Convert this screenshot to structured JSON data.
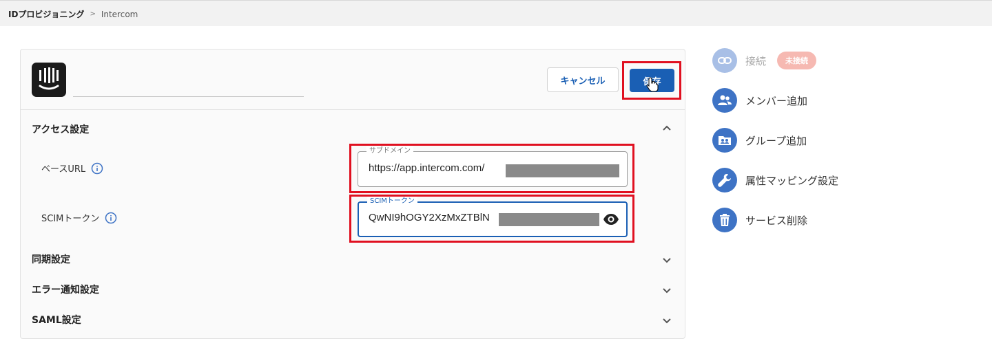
{
  "breadcrumb": {
    "root": "IDプロビジョニング",
    "separator": ">",
    "current": "Intercom"
  },
  "header": {
    "name_value": "",
    "cancel_label": "キャンセル",
    "save_label": "保存"
  },
  "access": {
    "title": "アクセス設定",
    "base_url": {
      "label": "ベースURL",
      "legend": "サブドメイン",
      "value": "https://app.intercom.com/"
    },
    "scim_token": {
      "label": "SCIMトークン",
      "legend": "SCIMトークン",
      "value": "QwNI9hOGY2XzMxZTBlN"
    }
  },
  "sections": {
    "sync": "同期設定",
    "error_notify": "エラー通知設定",
    "saml": "SAML設定"
  },
  "sidebar": {
    "connect": {
      "label": "接続",
      "badge": "未接続"
    },
    "add_member": "メンバー追加",
    "add_group": "グループ追加",
    "attr_mapping": "属性マッピング設定",
    "delete_service": "サービス削除"
  },
  "colors": {
    "primary": "#1a5fb4",
    "highlight": "#e01020",
    "badge_bg": "#f6b9b2",
    "icon_bg": "#3e73c5"
  }
}
